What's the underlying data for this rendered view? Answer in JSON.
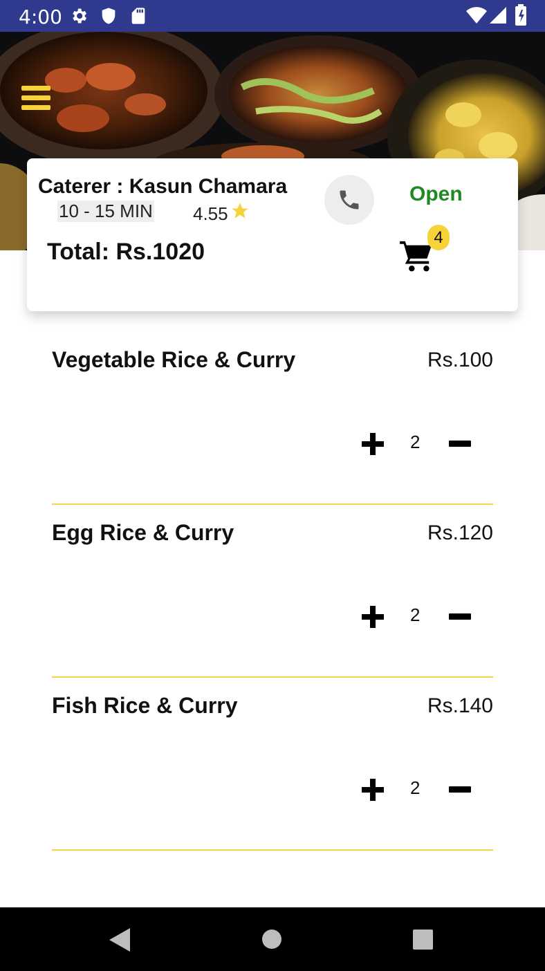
{
  "status_bar": {
    "time": "4:00",
    "icons": [
      "gear-icon",
      "shield-icon",
      "sd-card-icon",
      "wifi-icon",
      "signal-icon",
      "battery-icon"
    ]
  },
  "hero": {
    "image": "food-banner-photo",
    "menu_icon": "hamburger-menu-icon"
  },
  "caterer": {
    "name": "Caterer : Kasun Chamara",
    "delivery_time": "10 - 15 MIN",
    "rating": "4.55",
    "status": "Open",
    "total": "Total: Rs.1020",
    "cart_count": "4"
  },
  "items": [
    {
      "name": "Vegetable Rice & Curry",
      "price": "Rs.100",
      "quantity": "2"
    },
    {
      "name": "Egg Rice & Curry",
      "price": "Rs.120",
      "quantity": "2"
    },
    {
      "name": "Fish Rice & Curry",
      "price": "Rs.140",
      "quantity": "2"
    }
  ],
  "colors": {
    "status_bar": "#2f3a8f",
    "accent_yellow": "#f7d33a",
    "open_green": "#1f8a1f"
  },
  "nav_bar": {
    "icons": [
      "back-icon",
      "home-icon",
      "recents-icon"
    ]
  }
}
